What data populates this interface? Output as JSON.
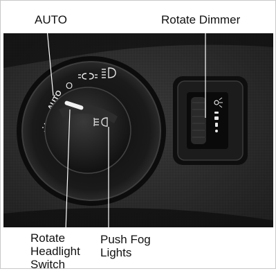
{
  "callouts": {
    "auto": "AUTO",
    "dimmer": "Rotate Dimmer",
    "headlight": "Rotate Headlight Switch",
    "fog": "Push Fog Lights"
  },
  "knob_markings": {
    "auto": "AUTO",
    "off": "O"
  },
  "colors": {
    "panel": "#2c2c2c",
    "bezel": "#141414",
    "knob": "#1b1b1b",
    "symbol": "#e8e8e8",
    "background": "#ffffff"
  },
  "icons": [
    "parking-lights-icon",
    "headlights-icon",
    "fog-light-icon",
    "dashboard-light-icon",
    "brightness-icon"
  ]
}
